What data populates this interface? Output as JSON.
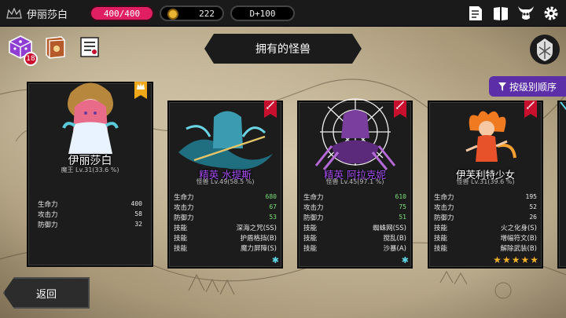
{
  "player": {
    "name": "伊丽莎白"
  },
  "resources": {
    "hp": "400/400",
    "gold": "222",
    "day": "D+100"
  },
  "header": {
    "title": "拥有的怪兽",
    "badge_count": "18"
  },
  "sort_button": {
    "label": "按级别顺序"
  },
  "back_button": {
    "label": "返回"
  },
  "stat_labels": {
    "hp": "生命力",
    "atk": "攻击力",
    "def": "防御力",
    "skill": "技能"
  },
  "cards": [
    {
      "name": "伊丽莎白",
      "sub": "魔王 Lv.31(33.6 %)",
      "stats": {
        "hp": "400",
        "atk": "58",
        "def": "32"
      }
    },
    {
      "name": "精英 水提斯",
      "sub": "怪兽 Lv.49(58.5 %)",
      "stats": {
        "hp": "680",
        "atk": "67",
        "def": "53"
      },
      "skills": [
        "深海之咒(SS)",
        "护盾格挡(B)",
        "魔力屏障(S)"
      ]
    },
    {
      "name": "精英 阿拉克妮",
      "sub": "怪兽 Lv.45(97.1 %)",
      "stats": {
        "hp": "610",
        "atk": "75",
        "def": "51"
      },
      "skills": [
        "蜘蛛网(SS)",
        "搅乱(B)",
        "沙暴(A)"
      ]
    },
    {
      "name": "伊芙利特少女",
      "sub": "怪兽 Lv.31(39.6 %)",
      "stats": {
        "hp": "195",
        "atk": "52",
        "def": "26"
      },
      "skills": [
        "火之化身(S)",
        "增幅符文(B)",
        "解除武装(B)"
      ],
      "stars": 5
    }
  ],
  "colors": {
    "hp_pill": "#e01f63",
    "sort_button": "#5c2ea8",
    "elite_name": "#a54ef0",
    "star": "#f3b22a"
  }
}
